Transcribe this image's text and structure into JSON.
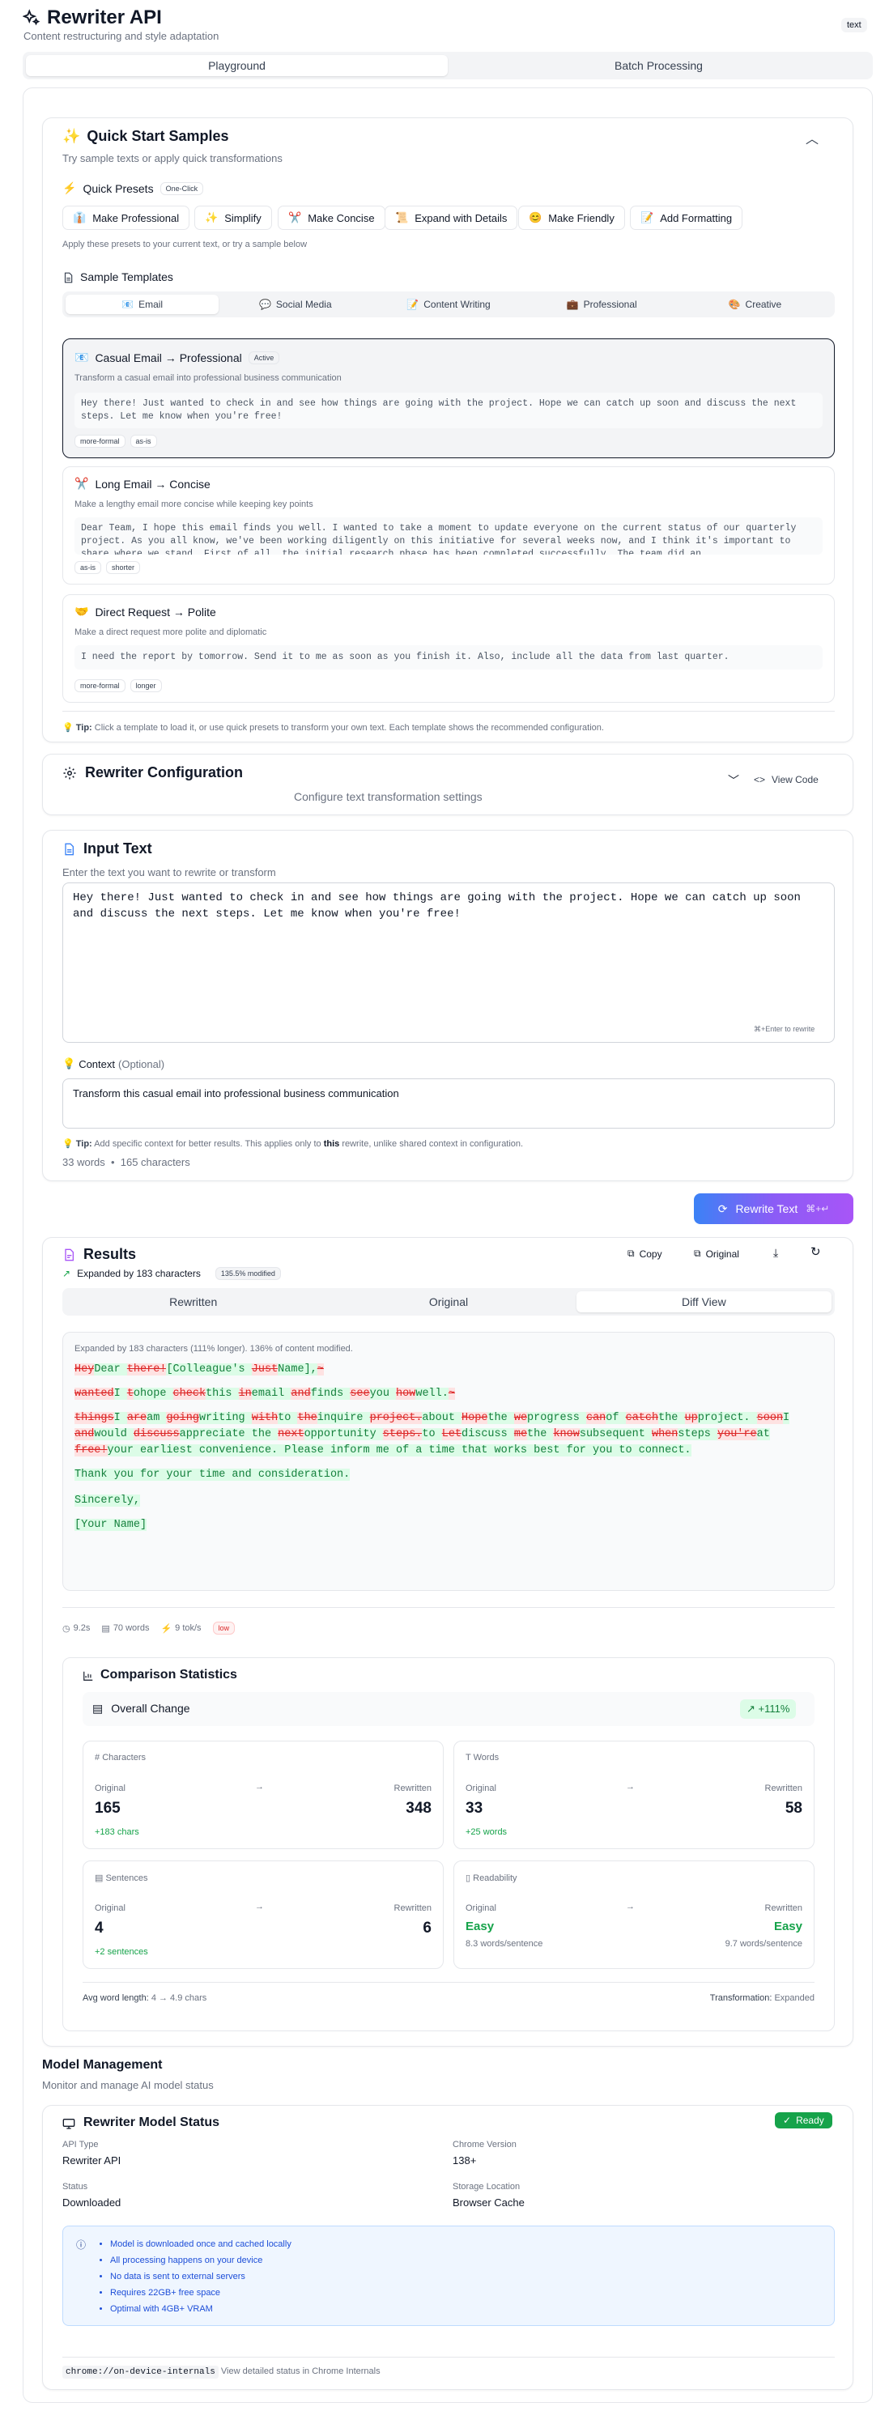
{
  "app": {
    "title": "Rewriter API",
    "subtitle": "Content restructuring and style adaptation",
    "badge": "text"
  },
  "mainTabs": [
    "Playground",
    "Batch Processing"
  ],
  "quickStart": {
    "title": "Quick Start Samples",
    "subtitle": "Try sample texts or apply quick transformations",
    "presetsTitle": "Quick Presets",
    "presetsBadge": "One-Click",
    "presets": [
      "Make Professional",
      "Simplify",
      "Make Concise",
      "Expand with Details",
      "Make Friendly",
      "Add Formatting"
    ],
    "presetsNote": "Apply these presets to your current text, or try a sample below",
    "templatesTitle": "Sample Templates",
    "templateTabs": [
      "Email",
      "Social Media",
      "Content Writing",
      "Professional",
      "Creative"
    ],
    "samples": [
      {
        "title": "Casual Email → Professional",
        "badge": "Active",
        "desc": "Transform a casual email into professional business communication",
        "text": "Hey there! Just wanted to check in and see how things are going with the project. Hope we can catch up soon and discuss the next steps. Let me know when you're free!",
        "tags": [
          "more-formal",
          "as-is"
        ]
      },
      {
        "title": "Long Email → Concise",
        "desc": "Make a lengthy email more concise while keeping key points",
        "text": "Dear Team, I hope this email finds you well. I wanted to take a moment to update everyone on the current status of our quarterly project. As you all know, we've been working diligently on this initiative for several weeks now, and I think it's important to share where we stand. First of all, the initial research phase has been completed successfully. The team did an",
        "tags": [
          "as-is",
          "shorter"
        ]
      },
      {
        "title": "Direct Request → Polite",
        "desc": "Make a direct request more polite and diplomatic",
        "text": "I need the report by tomorrow. Send it to me as soon as you finish it. Also, include all the data from last quarter.",
        "tags": [
          "more-formal",
          "longer"
        ]
      }
    ],
    "tipLabel": "Tip:",
    "tip": "Click a template to load it, or use quick presets to transform your own text. Each template shows the recommended configuration."
  },
  "config": {
    "title": "Rewriter Configuration",
    "subtitle": "Configure text transformation settings",
    "viewCode": "View Code"
  },
  "input": {
    "title": "Input Text",
    "subtitle": "Enter the text you want to rewrite or transform",
    "value": "Hey there! Just wanted to check in and see how things are going with the project. Hope we can catch up soon and discuss the next steps. Let me know when you're free!",
    "hint": "⌘+Enter to rewrite",
    "contextLabel": "Context",
    "contextOptional": "(Optional)",
    "contextValue": "Transform this casual email into professional business communication",
    "tipLabel": "Tip:",
    "tipPre": "Add specific context for better results. This applies only to",
    "tipBold": "this",
    "tipPost": "rewrite, unlike shared context in configuration.",
    "words": "33 words",
    "chars": "165 characters"
  },
  "rewriteButton": "Rewrite Text",
  "rewriteShortcut": "⌘+↵",
  "results": {
    "title": "Results",
    "expanded": "Expanded by 183 characters",
    "modified": "135.5% modified",
    "copy": "Copy",
    "original": "Original",
    "tabs": [
      "Rewritten",
      "Original",
      "Diff View"
    ],
    "diffSummary": "Expanded by 183 characters (111% longer). 136% of content modified.",
    "diff": [
      [
        [
          "d",
          "Hey"
        ],
        [
          "i",
          "Dear "
        ],
        [
          "d",
          "there!"
        ],
        [
          "i",
          "[Colleague's "
        ],
        [
          "d",
          "Just"
        ],
        [
          "i",
          "Name],"
        ],
        [
          "d",
          "~"
        ]
      ],
      [
        [
          "d",
          "wanted"
        ],
        [
          "i",
          "I "
        ],
        [
          "d",
          "t"
        ],
        [
          "i",
          "o"
        ],
        [
          "i",
          "hope "
        ],
        [
          "d",
          "check"
        ],
        [
          "i",
          "this "
        ],
        [
          "d",
          "in"
        ],
        [
          "i",
          "email "
        ],
        [
          "d",
          "and"
        ],
        [
          "i",
          "finds "
        ],
        [
          "d",
          "see"
        ],
        [
          "i",
          "you "
        ],
        [
          "d",
          "how"
        ],
        [
          "i",
          "well."
        ],
        [
          "d",
          "~"
        ]
      ],
      [
        [
          "d",
          "things"
        ],
        [
          "i",
          "I "
        ],
        [
          "d",
          "are"
        ],
        [
          "i",
          "am "
        ],
        [
          "d",
          "going"
        ],
        [
          "i",
          "writing "
        ],
        [
          "d",
          "with"
        ],
        [
          "i",
          "to "
        ],
        [
          "d",
          "the"
        ],
        [
          "i",
          "inquire "
        ],
        [
          "d",
          "project."
        ],
        [
          "i",
          "about "
        ],
        [
          "d",
          "Hope"
        ],
        [
          "i",
          "the "
        ],
        [
          "d",
          "we"
        ],
        [
          "i",
          "progress "
        ],
        [
          "d",
          "can"
        ],
        [
          "i",
          "of "
        ],
        [
          "d",
          "catch"
        ],
        [
          "i",
          "the "
        ],
        [
          "d",
          "up"
        ],
        [
          "i",
          "project. "
        ],
        [
          "d",
          "soon"
        ],
        [
          "i",
          "I "
        ],
        [
          "d",
          "and"
        ],
        [
          "i",
          "would "
        ],
        [
          "d",
          "discuss"
        ],
        [
          "i",
          "appreciate the "
        ],
        [
          "d",
          "next"
        ],
        [
          "i",
          "opportunity "
        ],
        [
          "d",
          "steps."
        ],
        [
          "i",
          "to "
        ],
        [
          "d",
          "Let"
        ],
        [
          "i",
          "discuss "
        ],
        [
          "d",
          "me"
        ],
        [
          "i",
          "the "
        ],
        [
          "d",
          "know"
        ],
        [
          "i",
          "subsequent "
        ],
        [
          "d",
          "when"
        ],
        [
          "i",
          "steps "
        ],
        [
          "d",
          "you're"
        ],
        [
          "i",
          "at "
        ],
        [
          "d",
          "free!"
        ],
        [
          "i",
          "your earliest convenience. Please inform me of a time that works best for you to connect."
        ]
      ],
      [
        [
          "i",
          "Thank you for your time and consideration."
        ]
      ],
      [
        [
          "i",
          "Sincerely,"
        ]
      ],
      [
        [
          "i",
          "[Your Name]"
        ]
      ]
    ],
    "time": "9.2s",
    "wordsCount": "70 words",
    "speed": "9 tok/s",
    "quality": "low"
  },
  "stats": {
    "title": "Comparison Statistics",
    "overall": "Overall Change",
    "overallValue": "+111%",
    "characters": {
      "label": "Characters",
      "original": "165",
      "rewritten": "348",
      "delta": "+183 chars"
    },
    "words": {
      "label": "Words",
      "original": "33",
      "rewritten": "58",
      "delta": "+25 words"
    },
    "sentences": {
      "label": "Sentences",
      "original": "4",
      "rewritten": "6",
      "delta": "+2 sentences"
    },
    "readability": {
      "label": "Readability",
      "original": "Easy",
      "rewritten": "Easy",
      "origNote": "8.3 words/sentence",
      "rewNote": "9.7 words/sentence"
    },
    "originalLabel": "Original",
    "rewrittenLabel": "Rewritten",
    "avgLabel": "Avg word length:",
    "avgValue": "4 → 4.9 chars",
    "transformLabel": "Transformation:",
    "transformValue": "Expanded"
  },
  "model": {
    "sectionTitle": "Model Management",
    "sectionSubtitle": "Monitor and manage AI model status",
    "title": "Rewriter Model Status",
    "status": "Ready",
    "fields": [
      {
        "label": "API Type",
        "value": "Rewriter API"
      },
      {
        "label": "Chrome Version",
        "value": "138+"
      },
      {
        "label": "Status",
        "value": "Downloaded"
      },
      {
        "label": "Storage Location",
        "value": "Browser Cache"
      }
    ],
    "notes": [
      "Model is downloaded once and cached locally",
      "All processing happens on your device",
      "No data is sent to external servers",
      "Requires 22GB+ free space",
      "Optimal with 4GB+ VRAM"
    ],
    "link": "chrome://on-device-internals",
    "linkNote": "View detailed status in Chrome Internals"
  }
}
